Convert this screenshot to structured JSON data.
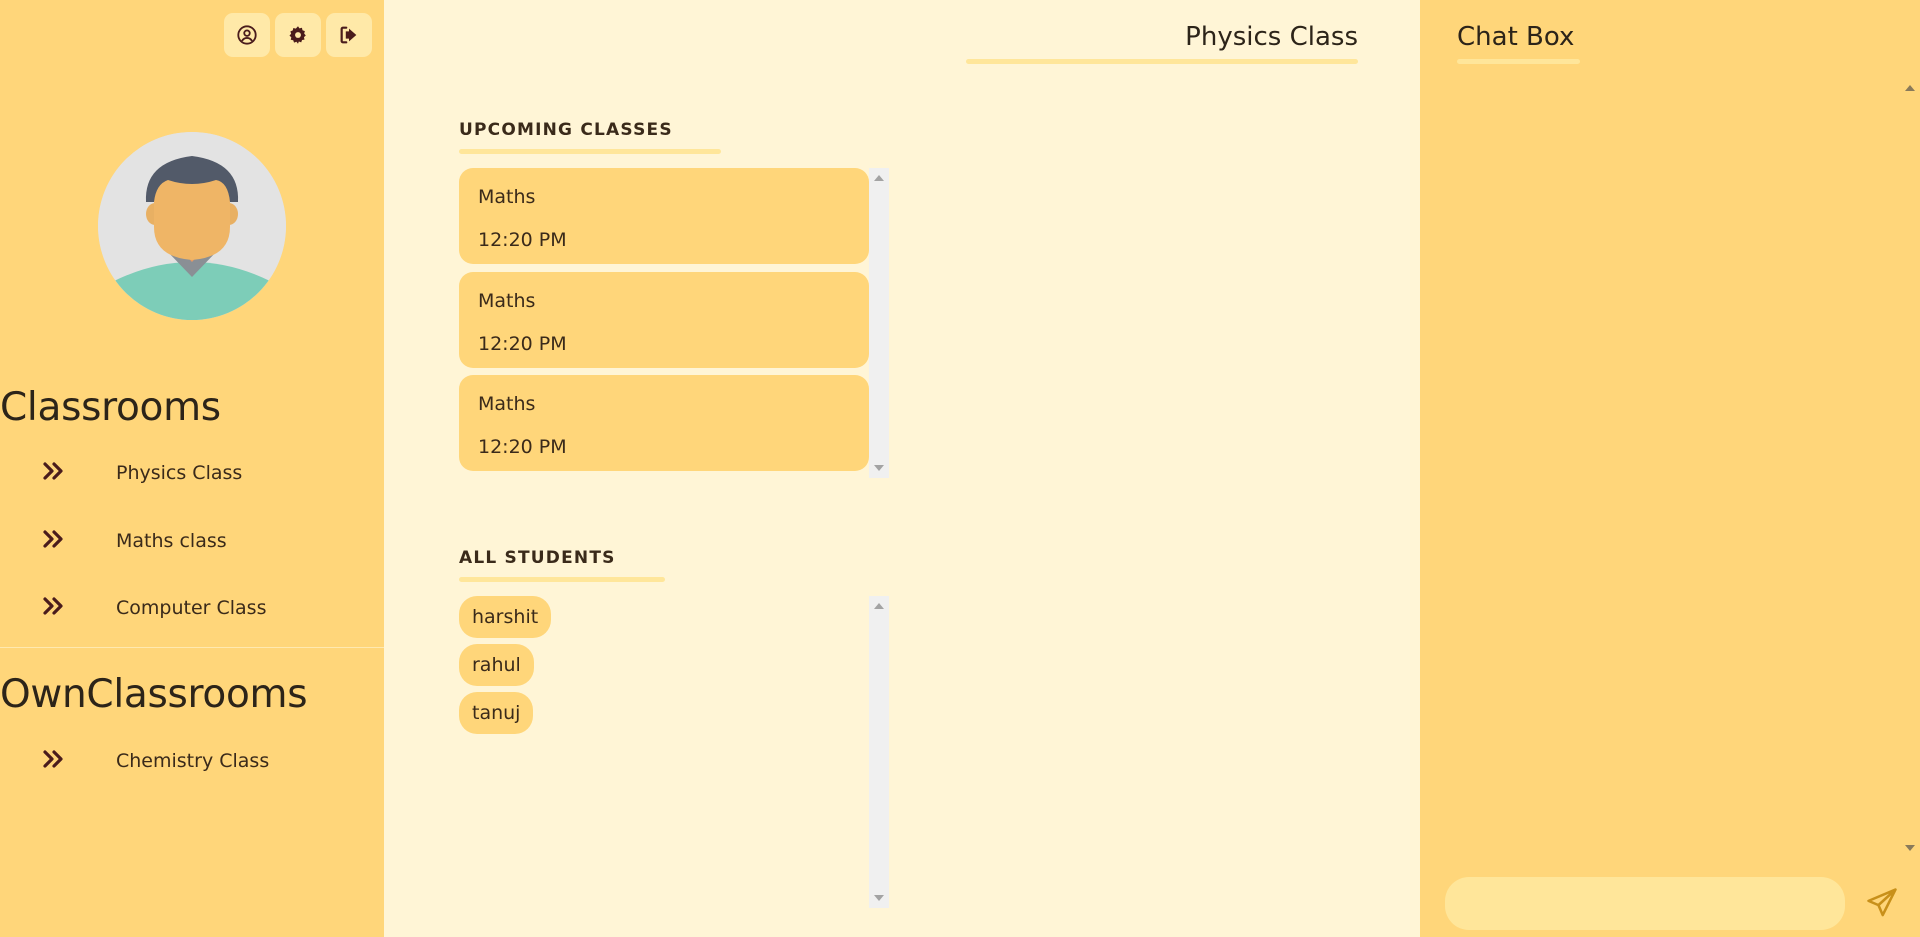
{
  "sidebar": {
    "icons": [
      "user-circle-icon",
      "gear-icon",
      "sign-out-icon"
    ],
    "classrooms_title": "Classrooms",
    "classrooms": [
      {
        "label": "Physics Class"
      },
      {
        "label": "Maths class"
      },
      {
        "label": "Computer Class"
      }
    ],
    "own_classrooms_title": "OwnClassrooms",
    "own_classrooms": [
      {
        "label": "Chemistry Class"
      }
    ]
  },
  "main": {
    "class_title": "Physics Class",
    "upcoming_heading": "UPCOMING CLASSES",
    "upcoming": [
      {
        "subject": "Maths",
        "time": "12:20 PM"
      },
      {
        "subject": "Maths",
        "time": "12:20 PM"
      },
      {
        "subject": "Maths",
        "time": "12:20 PM"
      }
    ],
    "students_heading": "ALL STUDENTS",
    "students": [
      "harshit",
      "rahul",
      "tanuj"
    ]
  },
  "chat": {
    "title": "Chat Box",
    "input_placeholder": "",
    "send_icon": "paper-plane-icon"
  },
  "colors": {
    "sidebar_bg": "#ffd67a",
    "main_bg": "#fff5d6",
    "accent_light": "#ffe69a",
    "icon_dark": "#4a1c1c",
    "send_icon": "#c8901a"
  }
}
